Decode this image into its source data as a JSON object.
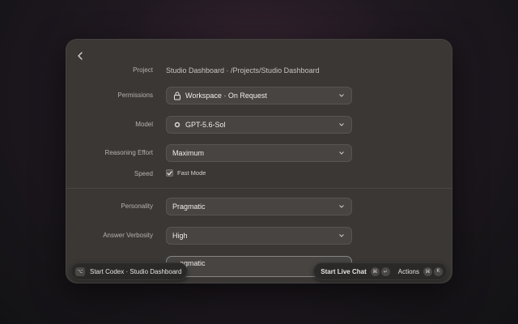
{
  "project": {
    "label": "Project",
    "value": "Studio Dashboard · /Projects/Studio Dashboard"
  },
  "permissions": {
    "label": "Permissions",
    "value": "Workspace · On Request"
  },
  "model": {
    "label": "Model",
    "value": "GPT-5.6-Sol"
  },
  "reasoning": {
    "label": "Reasoning Effort",
    "value": "Maximum"
  },
  "speed": {
    "label": "Speed",
    "option": "Fast Mode",
    "checked": true
  },
  "personality": {
    "label": "Personality",
    "value": "Pragmatic"
  },
  "verbosity": {
    "label": "Answer Verbosity",
    "value": "High"
  },
  "partial_field": {
    "value": "…agmatic"
  },
  "bottom": {
    "start_codex": "Start Codex · Studio Dashboard",
    "start_live_chat": "Start Live Chat",
    "live_chat_keys": [
      "⌘",
      "↵"
    ],
    "actions": "Actions",
    "actions_keys": [
      "⌘",
      "K"
    ],
    "left_key": "⌥"
  },
  "colors": {
    "window_bg": "#3a3735",
    "field_bg": "#474442",
    "pill_bg": "#2b2927"
  }
}
